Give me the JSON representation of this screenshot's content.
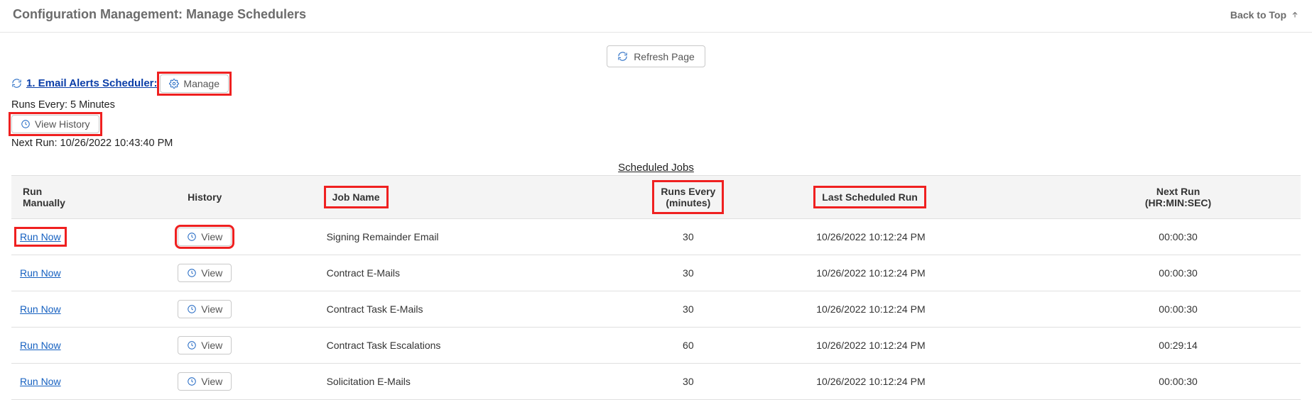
{
  "header": {
    "title": "Configuration Management: Manage Schedulers",
    "back_to_top": "Back to Top"
  },
  "actions": {
    "refresh_label": "Refresh Page",
    "manage_label": "Manage",
    "view_history_label": "View History"
  },
  "scheduler": {
    "title": "1. Email Alerts Scheduler:",
    "runs_every": "Runs Every: 5 Minutes",
    "next_run": "Next Run: 10/26/2022 10:43:40 PM"
  },
  "table": {
    "caption": "Scheduled Jobs",
    "headers": {
      "run_manually": "Run Manually",
      "history": "History",
      "job_name": "Job Name",
      "runs_every": "Runs Every",
      "runs_every_sub": "(minutes)",
      "last_run": "Last Scheduled Run",
      "next_run": "Next Run",
      "next_run_sub": "(HR:MIN:SEC)"
    },
    "labels": {
      "run_now": "Run Now",
      "view": "View"
    },
    "rows": [
      {
        "job_name": "Signing Remainder Email",
        "runs_every": "30",
        "last_run": "10/26/2022 10:12:24 PM",
        "next_run": "00:00:30"
      },
      {
        "job_name": "Contract E-Mails",
        "runs_every": "30",
        "last_run": "10/26/2022 10:12:24 PM",
        "next_run": "00:00:30"
      },
      {
        "job_name": "Contract Task E-Mails",
        "runs_every": "30",
        "last_run": "10/26/2022 10:12:24 PM",
        "next_run": "00:00:30"
      },
      {
        "job_name": "Contract Task Escalations",
        "runs_every": "60",
        "last_run": "10/26/2022 10:12:24 PM",
        "next_run": "00:29:14"
      },
      {
        "job_name": "Solicitation E-Mails",
        "runs_every": "30",
        "last_run": "10/26/2022 10:12:24 PM",
        "next_run": "00:00:30"
      }
    ]
  }
}
